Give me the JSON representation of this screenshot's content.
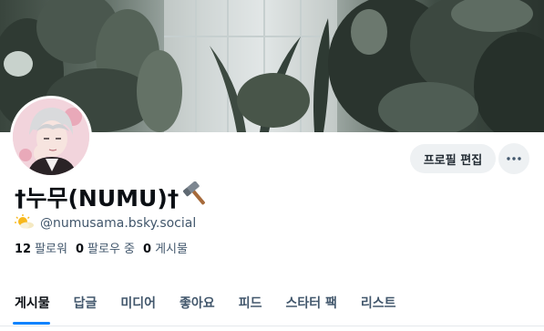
{
  "profile": {
    "display_name": "†누무(NUMU)†",
    "handle": "@numusama.bsky.social",
    "edit_label": "프로필 편집",
    "more_label": "···"
  },
  "stats": {
    "followers_count": "12",
    "followers_label": "팔로워",
    "following_count": "0",
    "following_label": "팔로우 중",
    "posts_count": "0",
    "posts_label": "게시물"
  },
  "tabs": [
    {
      "label": "게시물",
      "active": true
    },
    {
      "label": "답글",
      "active": false
    },
    {
      "label": "미디어",
      "active": false
    },
    {
      "label": "좋아요",
      "active": false
    },
    {
      "label": "피드",
      "active": false
    },
    {
      "label": "스타터 팩",
      "active": false
    },
    {
      "label": "리스트",
      "active": false
    }
  ],
  "icons": {
    "name_suffix": "hammer-icon",
    "handle_prefix": "sun-behind-cloud-icon",
    "more": "ellipsis-icon"
  },
  "colors": {
    "accent": "#1083fe",
    "text_primary": "#0b0f14",
    "text_secondary": "#42576c",
    "button_bg": "#eef1f3"
  }
}
